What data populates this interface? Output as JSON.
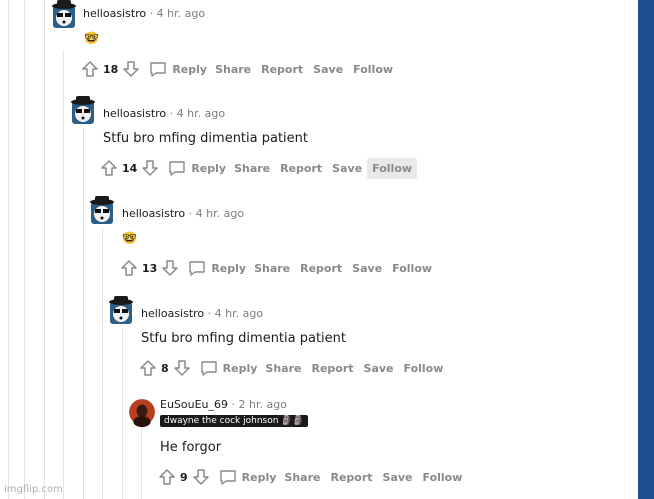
{
  "comments": [
    {
      "user": "helloasistro",
      "time": "4 hr. ago",
      "emoji": "🤓",
      "text": "",
      "score": "18"
    },
    {
      "user": "helloasistro",
      "time": "4 hr. ago",
      "emoji": "",
      "text": "Stfu bro mfing dimentia patient",
      "score": "14"
    },
    {
      "user": "helloasistro",
      "time": "4 hr. ago",
      "emoji": "🤓",
      "text": "",
      "score": "13"
    },
    {
      "user": "helloasistro",
      "time": "4 hr. ago",
      "emoji": "",
      "text": "Stfu bro mfing dimentia patient",
      "score": "8"
    },
    {
      "user": "EuSouEu_69",
      "time": "2 hr. ago",
      "flair": "dwayne the cock johnson 🗿🗿",
      "emoji": "",
      "text": "He forgor",
      "score": "9"
    }
  ],
  "actions": {
    "reply": "Reply",
    "share": "Share",
    "report": "Report",
    "save": "Save",
    "follow": "Follow"
  },
  "separator": "·",
  "watermark": "imgflip.com",
  "colors": {
    "accent_bar": "#1d4f91",
    "meta_gray": "#7c7c7c",
    "action_gray": "#878a8c"
  },
  "icons": [
    "upvote-icon",
    "downvote-icon",
    "comment-icon",
    "panda-avatar-icon"
  ]
}
